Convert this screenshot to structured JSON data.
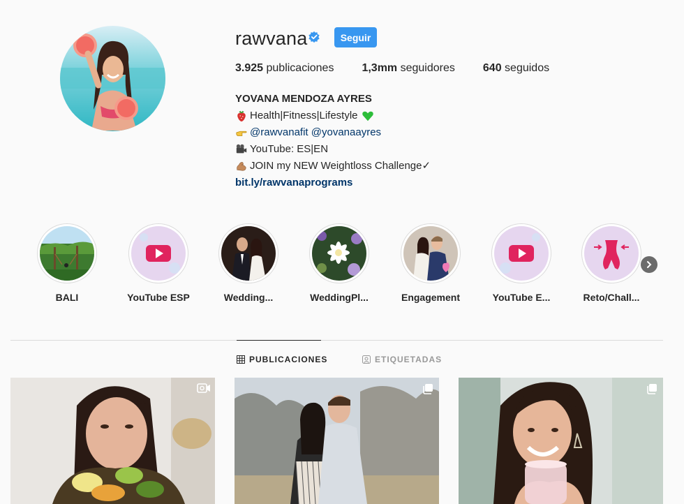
{
  "profile": {
    "username": "rawvana",
    "follow_label": "Seguir",
    "stats": [
      {
        "count": "3.925",
        "label": "publicaciones"
      },
      {
        "count": "1,3mm",
        "label": "seguidores"
      },
      {
        "count": "640",
        "label": "seguidos"
      }
    ],
    "full_name": "YOVANA MENDOZA AYRES",
    "bio": {
      "line1": "Health|Fitness|Lifestyle",
      "line2_mention1": "@rawvanafit",
      "line2_mention2": "@yovanaayres",
      "line3": "YouTube: ES|EN",
      "line4": "JOIN my NEW Weightloss Challenge✓",
      "link": "bit.ly/rawvanaprograms"
    }
  },
  "highlights": [
    {
      "label": "BALI"
    },
    {
      "label": "YouTube ESP"
    },
    {
      "label": "Wedding..."
    },
    {
      "label": "WeddingPl..."
    },
    {
      "label": "Engagement"
    },
    {
      "label": "YouTube E..."
    },
    {
      "label": "Reto/Chall..."
    }
  ],
  "tabs": {
    "posts": "PUBLICACIONES",
    "tagged": "ETIQUETADAS"
  },
  "icons": {
    "verified": "verified-badge-icon",
    "next": "chevron-right-icon",
    "grid": "grid-icon",
    "tagged": "tagged-icon",
    "video": "video-camera-icon",
    "carousel": "carousel-icon"
  },
  "colors": {
    "accent": "#3897f0",
    "link": "#003569",
    "text": "#262626",
    "muted": "#999999",
    "youtube": "#e0245e"
  }
}
